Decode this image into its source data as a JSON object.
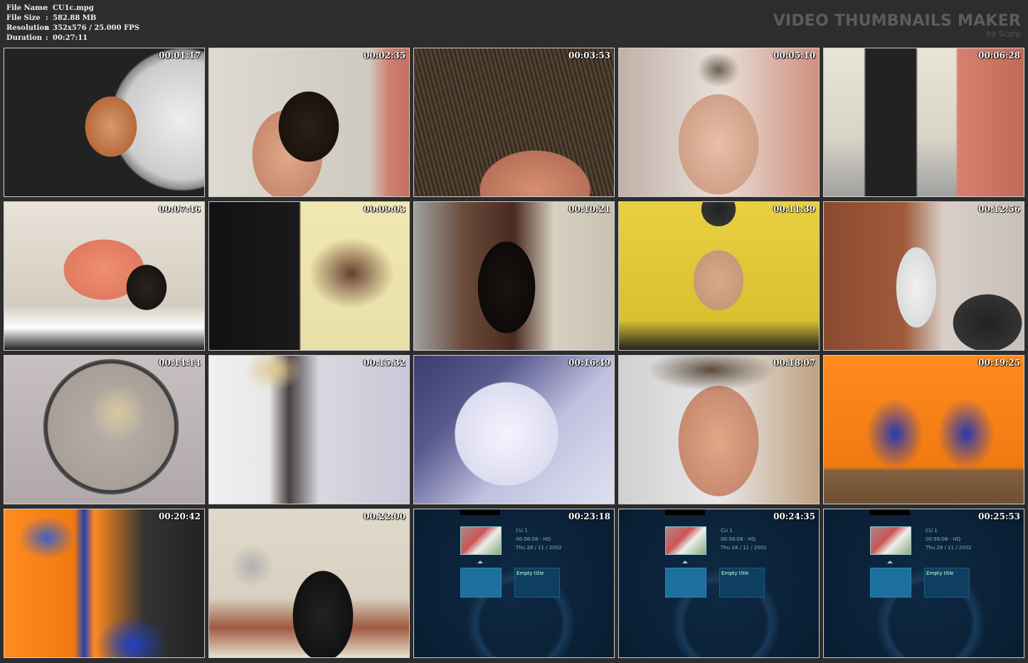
{
  "meta": [
    {
      "key": "File Name",
      "value": "CU1c.mpg"
    },
    {
      "key": "File Size",
      "value": "582.88 MB"
    },
    {
      "key": "Resolution",
      "value": "352x576 / 25.000 FPS"
    },
    {
      "key": "Duration",
      "value": "00:27:11"
    }
  ],
  "brand": {
    "title": "VIDEO THUMBNAILS MAKER",
    "subtitle": "by Scorp"
  },
  "dvd": {
    "line1": "CU 1",
    "line2": "00:56:08 - HQ",
    "line3": "Thu 28 / 11 / 2002",
    "empty_title": "Empty title"
  },
  "thumbs": [
    {
      "time": "00:01:17",
      "scene": "woman with curly red hair in salon mirror"
    },
    {
      "time": "00:02:35",
      "scene": "profile of woman getting wet dark hair cut"
    },
    {
      "time": "00:03:53",
      "scene": "close-up of scissors cutting hair near ear"
    },
    {
      "time": "00:05:10",
      "scene": "woman with short wet hair facing camera"
    },
    {
      "time": "00:06:28",
      "scene": "woman standing with arms crossed in salon"
    },
    {
      "time": "00:07:46",
      "scene": "stylist in pink shirt cutting client hair"
    },
    {
      "time": "00:09:03",
      "scene": "long dark hair being cut with scissors"
    },
    {
      "time": "00:10:21",
      "scene": "woman with dark hair in salon chair"
    },
    {
      "time": "00:11:39",
      "scene": "woman with short hair against yellow wall"
    },
    {
      "time": "00:12:56",
      "scene": "barber cutting hair in brick-walled salon"
    },
    {
      "time": "00:14:14",
      "scene": "reflection of stylist and client in round mirror"
    },
    {
      "time": "00:15:32",
      "scene": "stylist in white coat at work"
    },
    {
      "time": "00:16:49",
      "scene": "overexposed blurry frame"
    },
    {
      "time": "00:18:07",
      "scene": "woman with short hair, eyes closed"
    },
    {
      "time": "00:19:25",
      "scene": "orange and blue salon with clients"
    },
    {
      "time": "00:20:42",
      "scene": "orange salon with blue chair and stylist"
    },
    {
      "time": "00:22:00",
      "scene": "woman seated under hood dryers"
    },
    {
      "time": "00:23:18",
      "scene": "DVD menu"
    },
    {
      "time": "00:24:35",
      "scene": "DVD menu"
    },
    {
      "time": "00:25:53",
      "scene": "DVD menu"
    }
  ]
}
